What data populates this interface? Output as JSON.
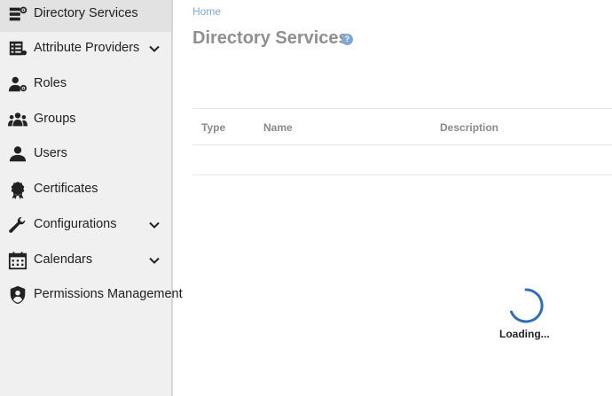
{
  "sidebar": {
    "items": [
      {
        "label": "Directory Services",
        "icon": "directory-services-icon",
        "active": true,
        "expandable": false
      },
      {
        "label": "Attribute Providers",
        "icon": "attribute-providers-icon",
        "active": false,
        "expandable": true
      },
      {
        "label": "Roles",
        "icon": "roles-icon",
        "active": false,
        "expandable": false
      },
      {
        "label": "Groups",
        "icon": "groups-icon",
        "active": false,
        "expandable": false
      },
      {
        "label": "Users",
        "icon": "users-icon",
        "active": false,
        "expandable": false
      },
      {
        "label": "Certificates",
        "icon": "certificates-icon",
        "active": false,
        "expandable": false
      },
      {
        "label": "Configurations",
        "icon": "wrench-icon",
        "active": false,
        "expandable": true
      },
      {
        "label": "Calendars",
        "icon": "calendar-icon",
        "active": false,
        "expandable": true
      },
      {
        "label": "Permissions Management",
        "icon": "shield-user-icon",
        "active": false,
        "expandable": false
      }
    ]
  },
  "breadcrumb": {
    "home": "Home"
  },
  "page": {
    "title": "Directory Services",
    "help": "?"
  },
  "table": {
    "columns": [
      "Type",
      "Name",
      "Description"
    ]
  },
  "loading": {
    "text": "Loading..."
  },
  "colors": {
    "accent": "#2f6fb5",
    "link": "#7ea6d6",
    "sidebar_bg": "#f0f0f0",
    "sidebar_active": "#e2e2e2"
  }
}
